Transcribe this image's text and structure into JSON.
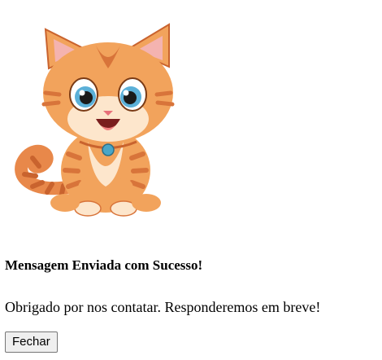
{
  "modal": {
    "image": {
      "icon": "cartoon-kitten",
      "colors": {
        "fur": "#f2a35c",
        "stripes": "#d8743a",
        "cream": "#fde6cc",
        "eyes": "#5bb0d8",
        "ear_inner": "#f4b3b0",
        "collar": "#4aa6c7"
      }
    },
    "title": "Mensagem Enviada com Sucesso!",
    "message": "Obrigado por nos contatar. Responderemos em breve!",
    "close_label": "Fechar"
  }
}
